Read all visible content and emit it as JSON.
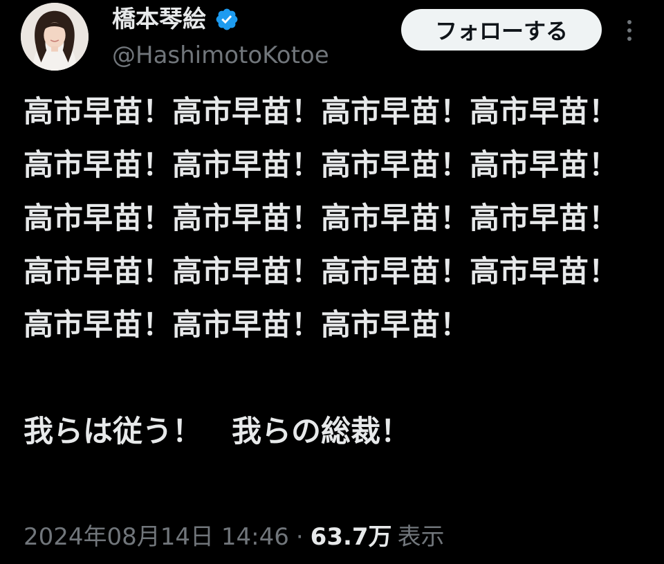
{
  "author": {
    "display_name": "橋本琴絵",
    "handle": "@HashimotoKotoe",
    "verified": true,
    "avatar_icon": "profile-photo"
  },
  "actions": {
    "follow_label": "フォローする",
    "more_icon": "vertical-ellipsis-icon"
  },
  "post": {
    "text": "高市早苗！高市早苗！高市早苗！高市早苗！高市早苗！高市早苗！高市早苗！高市早苗！高市早苗！高市早苗！高市早苗！高市早苗！高市早苗！高市早苗！高市早苗！高市早苗！高市早苗！高市早苗！高市早苗！\n\n我らは従う！　我らの総裁！",
    "timestamp": "2024年08月14日 14:46",
    "separator": "·",
    "views_count": "63.7万",
    "views_label": "表示"
  },
  "colors": {
    "background": "#000000",
    "primary_text": "#e7e9ea",
    "secondary_text": "#71767b",
    "verified_badge": "#1d9bf0",
    "follow_button_bg": "#eff3f4"
  }
}
